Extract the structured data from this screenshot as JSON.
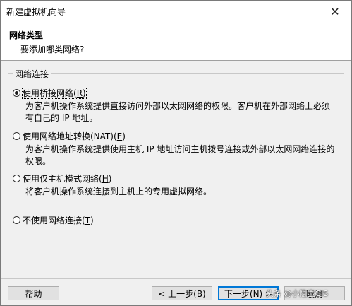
{
  "window": {
    "title": "新建虚拟机向导",
    "close_glyph": "✕"
  },
  "header": {
    "title": "网络类型",
    "subtitle": "要添加哪类网络?"
  },
  "group": {
    "legend": "网络连接",
    "options": [
      {
        "label_prefix": "使用桥接网络(",
        "hotkey": "R",
        "label_suffix": ")",
        "description": "为客户机操作系统提供直接访问外部以太网网络的权限。客户机在外部网络上必须有自己的 IP 地址。",
        "selected": true
      },
      {
        "label_prefix": "使用网络地址转换(NAT)(",
        "hotkey": "E",
        "label_suffix": ")",
        "description": "为客户机操作系统提供使用主机 IP 地址访问主机拨号连接或外部以太网网络连接的权限。",
        "selected": false
      },
      {
        "label_prefix": "使用仅主机模式网络(",
        "hotkey": "H",
        "label_suffix": ")",
        "description": "将客户机操作系统连接到主机上的专用虚拟网络。",
        "selected": false
      },
      {
        "label_prefix": "不使用网络连接(",
        "hotkey": "T",
        "label_suffix": ")",
        "description": "",
        "selected": false
      }
    ]
  },
  "buttons": {
    "help": "帮助",
    "back": "< 上一步(B)",
    "next": "下一步(N) >",
    "cancel": "取消"
  },
  "watermark": "头条 @小隐壶GIS"
}
